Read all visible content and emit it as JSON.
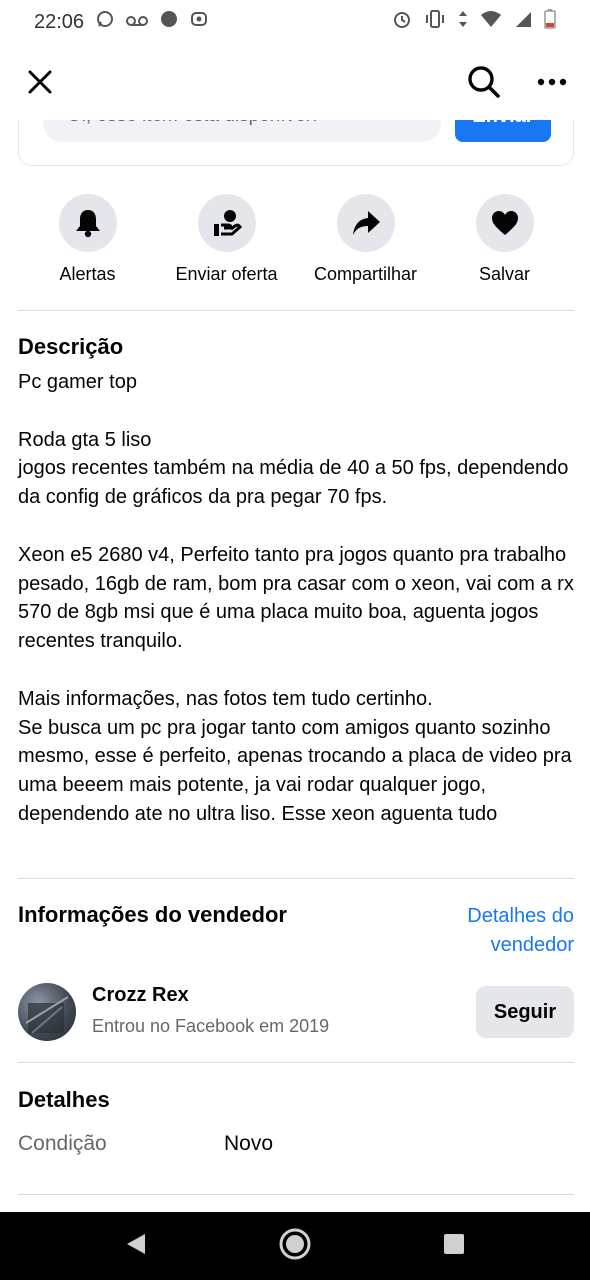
{
  "status_bar": {
    "time": "22:06",
    "left_icons": [
      "whatsapp-icon",
      "voicemail-icon",
      "android-icon",
      "record-icon"
    ],
    "right_icons": [
      "alarm-icon",
      "vibrate-icon",
      "data-arrows-icon",
      "wifi-icon",
      "signal-icon",
      "battery-icon"
    ]
  },
  "top_bar": {
    "left_icon": "close-icon",
    "right_icons": [
      "search-icon",
      "more-icon"
    ]
  },
  "message": {
    "placeholder": "Oi, esse item está disponível?",
    "send_label": "Enviar"
  },
  "actions": [
    {
      "label": "Alertas",
      "icon": "bell-icon"
    },
    {
      "label": "Enviar oferta",
      "icon": "offer-icon"
    },
    {
      "label": "Compartilhar",
      "icon": "share-icon"
    },
    {
      "label": "Salvar",
      "icon": "heart-icon"
    }
  ],
  "description": {
    "title": "Descrição",
    "text": "Pc gamer top\n\nRoda gta 5 liso\njogos recentes também na média de 40 a 50 fps, dependendo da config de gráficos da pra pegar 70 fps.\n\nXeon e5 2680 v4, Perfeito tanto pra jogos quanto pra trabalho pesado, 16gb de ram, bom pra casar com o xeon, vai com a rx 570 de 8gb msi que é uma placa muito boa, aguenta jogos recentes tranquilo.\n\nMais informações, nas fotos tem tudo certinho.\nSe busca um pc pra jogar tanto com amigos quanto sozinho mesmo, esse é perfeito, apenas trocando a placa de video pra uma beeem mais potente, ja vai rodar qualquer jogo, dependendo ate no ultra liso. Esse xeon aguenta tudo"
  },
  "seller": {
    "title": "Informações do vendedor",
    "details_link": "Detalhes do vendedor",
    "name": "Crozz Rex",
    "joined": "Entrou no Facebook em 2019",
    "follow_label": "Seguir"
  },
  "details": {
    "title": "Detalhes",
    "condition_label": "Condição",
    "condition_value": "Novo"
  },
  "nav_bar": {
    "icons": [
      "back-icon",
      "home-icon",
      "recents-icon"
    ]
  },
  "colors": {
    "accent": "#1877f2",
    "secondary_text": "#65676b",
    "button_gray": "#e4e6eb"
  }
}
